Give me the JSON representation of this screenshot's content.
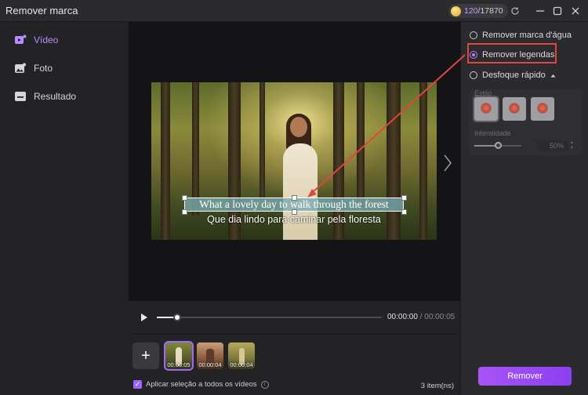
{
  "app": {
    "title": "Remover marca"
  },
  "credits": {
    "used": "120",
    "total": "/17870"
  },
  "window_controls": {
    "refresh_icon": "refresh-icon",
    "minimize_icon": "minimize-icon",
    "maximize_icon": "maximize-icon",
    "close_icon": "close-icon"
  },
  "sidebar": {
    "items": [
      {
        "label": "Vídeo",
        "icon": "video-icon",
        "active": true
      },
      {
        "label": "Foto",
        "icon": "photo-icon",
        "active": false
      },
      {
        "label": "Resultado",
        "icon": "result-folder-icon",
        "active": false
      }
    ]
  },
  "preview": {
    "subtitle_en": "What a lovely day to walk through the forest",
    "subtitle_pt": "Que dia lindo para caminar pela floresta",
    "next_icon": "chevron-right-icon"
  },
  "player": {
    "current_time": "00:00:00",
    "separator": " / ",
    "total_time": "00:00:05",
    "progress": 0.09
  },
  "thumbnails": {
    "add_label": "+",
    "items": [
      {
        "duration": "00:00:05",
        "selected": true
      },
      {
        "duration": "00:00:04",
        "selected": false
      },
      {
        "duration": "00:00:04",
        "selected": false
      }
    ],
    "apply_all_label": "Aplicar seleção a todos os vídeos",
    "apply_all_checked": true,
    "count_label": "3 item(ns)"
  },
  "options": {
    "watermark_label": "Remover marca d'água",
    "subtitles_label": "Remover legendas",
    "blur_label": "Desfoque rápido",
    "selected": "Remover legendas",
    "style_label": "Estilo",
    "intensity_label": "Intensidade",
    "intensity_value": "50%",
    "intensity": 0.5,
    "remove_button": "Remover"
  },
  "colors": {
    "accent": "#a855f7",
    "highlight_box": "#e0453f",
    "background": "#232325"
  }
}
